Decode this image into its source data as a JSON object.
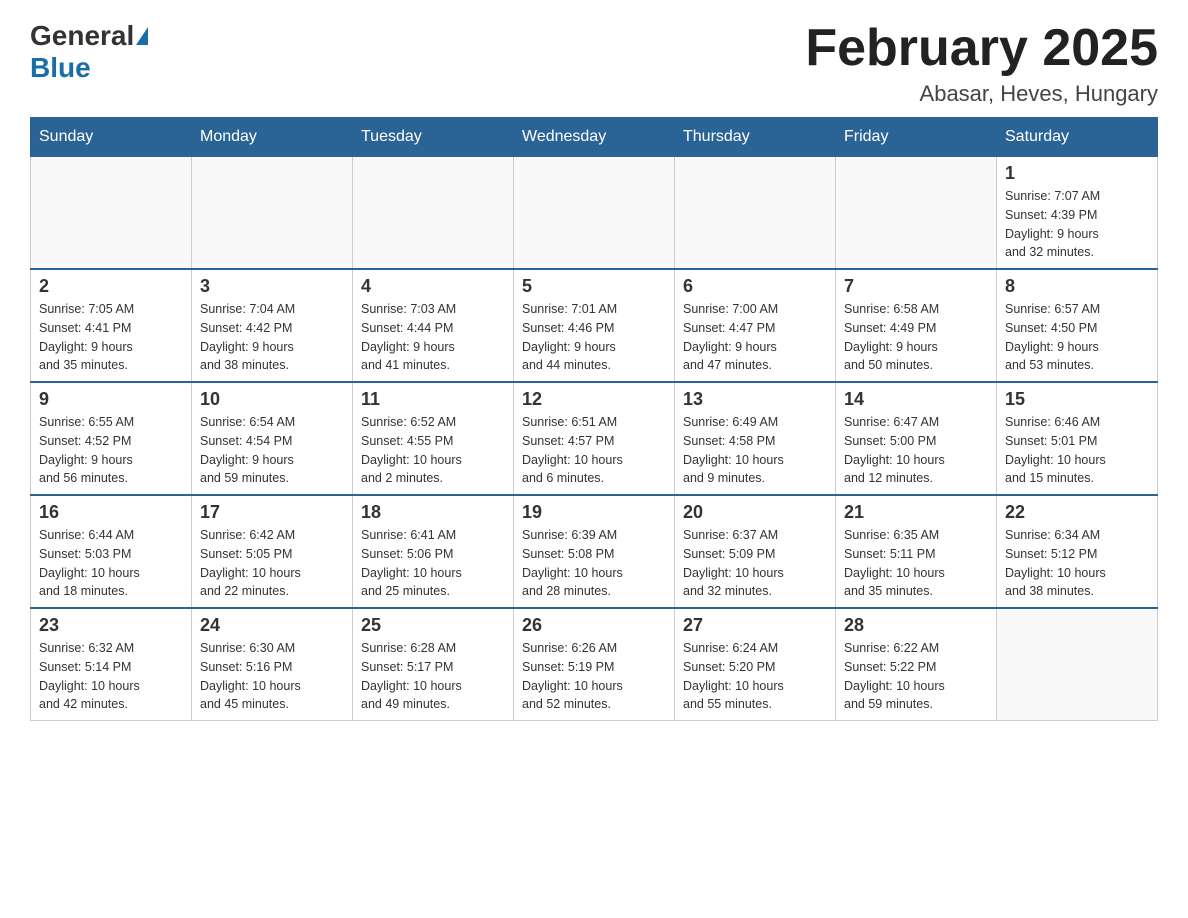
{
  "logo": {
    "general": "General",
    "blue": "Blue"
  },
  "title": "February 2025",
  "subtitle": "Abasar, Heves, Hungary",
  "weekdays": [
    "Sunday",
    "Monday",
    "Tuesday",
    "Wednesday",
    "Thursday",
    "Friday",
    "Saturday"
  ],
  "weeks": [
    [
      {
        "day": "",
        "info": ""
      },
      {
        "day": "",
        "info": ""
      },
      {
        "day": "",
        "info": ""
      },
      {
        "day": "",
        "info": ""
      },
      {
        "day": "",
        "info": ""
      },
      {
        "day": "",
        "info": ""
      },
      {
        "day": "1",
        "info": "Sunrise: 7:07 AM\nSunset: 4:39 PM\nDaylight: 9 hours\nand 32 minutes."
      }
    ],
    [
      {
        "day": "2",
        "info": "Sunrise: 7:05 AM\nSunset: 4:41 PM\nDaylight: 9 hours\nand 35 minutes."
      },
      {
        "day": "3",
        "info": "Sunrise: 7:04 AM\nSunset: 4:42 PM\nDaylight: 9 hours\nand 38 minutes."
      },
      {
        "day": "4",
        "info": "Sunrise: 7:03 AM\nSunset: 4:44 PM\nDaylight: 9 hours\nand 41 minutes."
      },
      {
        "day": "5",
        "info": "Sunrise: 7:01 AM\nSunset: 4:46 PM\nDaylight: 9 hours\nand 44 minutes."
      },
      {
        "day": "6",
        "info": "Sunrise: 7:00 AM\nSunset: 4:47 PM\nDaylight: 9 hours\nand 47 minutes."
      },
      {
        "day": "7",
        "info": "Sunrise: 6:58 AM\nSunset: 4:49 PM\nDaylight: 9 hours\nand 50 minutes."
      },
      {
        "day": "8",
        "info": "Sunrise: 6:57 AM\nSunset: 4:50 PM\nDaylight: 9 hours\nand 53 minutes."
      }
    ],
    [
      {
        "day": "9",
        "info": "Sunrise: 6:55 AM\nSunset: 4:52 PM\nDaylight: 9 hours\nand 56 minutes."
      },
      {
        "day": "10",
        "info": "Sunrise: 6:54 AM\nSunset: 4:54 PM\nDaylight: 9 hours\nand 59 minutes."
      },
      {
        "day": "11",
        "info": "Sunrise: 6:52 AM\nSunset: 4:55 PM\nDaylight: 10 hours\nand 2 minutes."
      },
      {
        "day": "12",
        "info": "Sunrise: 6:51 AM\nSunset: 4:57 PM\nDaylight: 10 hours\nand 6 minutes."
      },
      {
        "day": "13",
        "info": "Sunrise: 6:49 AM\nSunset: 4:58 PM\nDaylight: 10 hours\nand 9 minutes."
      },
      {
        "day": "14",
        "info": "Sunrise: 6:47 AM\nSunset: 5:00 PM\nDaylight: 10 hours\nand 12 minutes."
      },
      {
        "day": "15",
        "info": "Sunrise: 6:46 AM\nSunset: 5:01 PM\nDaylight: 10 hours\nand 15 minutes."
      }
    ],
    [
      {
        "day": "16",
        "info": "Sunrise: 6:44 AM\nSunset: 5:03 PM\nDaylight: 10 hours\nand 18 minutes."
      },
      {
        "day": "17",
        "info": "Sunrise: 6:42 AM\nSunset: 5:05 PM\nDaylight: 10 hours\nand 22 minutes."
      },
      {
        "day": "18",
        "info": "Sunrise: 6:41 AM\nSunset: 5:06 PM\nDaylight: 10 hours\nand 25 minutes."
      },
      {
        "day": "19",
        "info": "Sunrise: 6:39 AM\nSunset: 5:08 PM\nDaylight: 10 hours\nand 28 minutes."
      },
      {
        "day": "20",
        "info": "Sunrise: 6:37 AM\nSunset: 5:09 PM\nDaylight: 10 hours\nand 32 minutes."
      },
      {
        "day": "21",
        "info": "Sunrise: 6:35 AM\nSunset: 5:11 PM\nDaylight: 10 hours\nand 35 minutes."
      },
      {
        "day": "22",
        "info": "Sunrise: 6:34 AM\nSunset: 5:12 PM\nDaylight: 10 hours\nand 38 minutes."
      }
    ],
    [
      {
        "day": "23",
        "info": "Sunrise: 6:32 AM\nSunset: 5:14 PM\nDaylight: 10 hours\nand 42 minutes."
      },
      {
        "day": "24",
        "info": "Sunrise: 6:30 AM\nSunset: 5:16 PM\nDaylight: 10 hours\nand 45 minutes."
      },
      {
        "day": "25",
        "info": "Sunrise: 6:28 AM\nSunset: 5:17 PM\nDaylight: 10 hours\nand 49 minutes."
      },
      {
        "day": "26",
        "info": "Sunrise: 6:26 AM\nSunset: 5:19 PM\nDaylight: 10 hours\nand 52 minutes."
      },
      {
        "day": "27",
        "info": "Sunrise: 6:24 AM\nSunset: 5:20 PM\nDaylight: 10 hours\nand 55 minutes."
      },
      {
        "day": "28",
        "info": "Sunrise: 6:22 AM\nSunset: 5:22 PM\nDaylight: 10 hours\nand 59 minutes."
      },
      {
        "day": "",
        "info": ""
      }
    ]
  ]
}
